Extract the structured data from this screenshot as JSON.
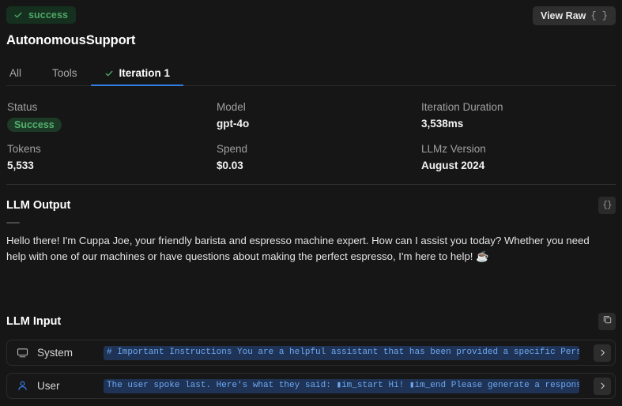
{
  "header": {
    "status_badge": "success",
    "status_badge_icon": "check-icon",
    "view_raw_label": "View Raw",
    "view_raw_braces": "{ }",
    "title": "AutonomousSupport"
  },
  "tabs": [
    {
      "label": "All",
      "active": false,
      "icon": null
    },
    {
      "label": "Tools",
      "active": false,
      "icon": null
    },
    {
      "label": "Iteration 1",
      "active": true,
      "icon": "check-icon"
    }
  ],
  "meta": [
    {
      "label": "Status",
      "value": "Success",
      "type": "pill"
    },
    {
      "label": "Model",
      "value": "gpt-4o",
      "type": "text"
    },
    {
      "label": "Iteration Duration",
      "value": "3,538ms",
      "type": "text"
    },
    {
      "label": "Tokens",
      "value": "5,533",
      "type": "text"
    },
    {
      "label": "Spend",
      "value": "$0.03",
      "type": "text"
    },
    {
      "label": "LLMz Version",
      "value": "August 2024",
      "type": "text"
    }
  ],
  "llm_output": {
    "title": "LLM Output",
    "json_icon_label": "{}",
    "text": "Hello there! I'm Cuppa Joe, your friendly barista and espresso machine expert. How can I assist you today? Whether you need help with one of our machines or have questions about making the perfect espresso, I'm here to help! ☕"
  },
  "llm_input": {
    "title": "LLM Input",
    "copy_icon": "copy-icon",
    "rows": [
      {
        "role": "System",
        "icon": "monitor-icon",
        "code": "# Important Instructions You are a helpful assistant that has been provided a specific Perso…",
        "expand_icon": "chevron-right-icon"
      },
      {
        "role": "User",
        "icon": "person-icon",
        "code": "The user spoke last. Here's what they said: ▮im_start Hi! ▮im_end Please generate a response…",
        "expand_icon": "chevron-right-icon"
      }
    ]
  },
  "colors": {
    "background": "#161616",
    "accent_blue": "#2f7fe8",
    "success_green": "#4ea866",
    "code_text": "#6fa8f0",
    "code_bg": "#1e3356"
  }
}
